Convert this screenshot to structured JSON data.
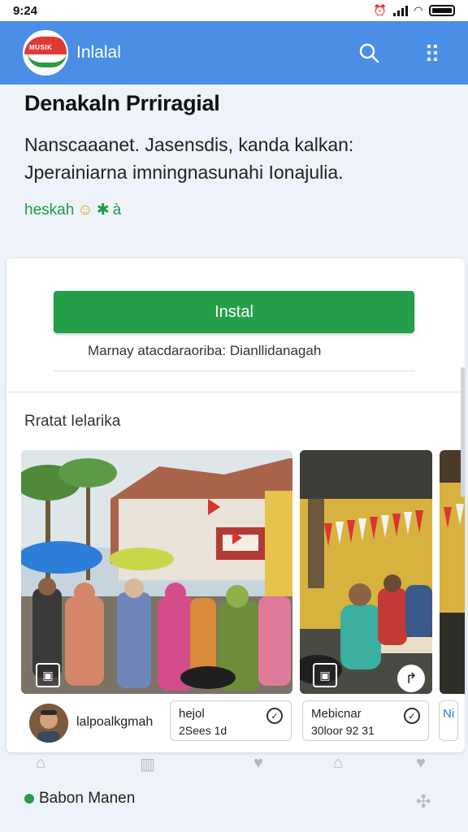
{
  "status_bar": {
    "time": "9:24"
  },
  "app_bar": {
    "logo_text": "MUSIK",
    "app_name": "Inlalal"
  },
  "header": {
    "title": "Denakaln Prriragial",
    "description": "Nansca​aanet. Jasensdis, kanda kalkan: Jperainiarna imningnasunahi Ionajulia.",
    "tagline": "heskah"
  },
  "install": {
    "button_label": "Instal",
    "note": "Marnay atacdaraoriba: Dianllidanagah"
  },
  "gallery": {
    "section_title": "Rratat Ielarika"
  },
  "profile": {
    "name": "lalpoalkgmah"
  },
  "chips": [
    {
      "line1": "hejol",
      "line2": "2Sees 1d"
    },
    {
      "line1": "Mebicnar",
      "line2": "30loor 92 31"
    },
    {
      "line1": "Ni",
      "line2": ""
    }
  ],
  "footer": {
    "label": "Babon Manen"
  },
  "colors": {
    "app_bar": "#4a8ee6",
    "install_button": "#23a047",
    "tagline": "#1e9b45"
  }
}
